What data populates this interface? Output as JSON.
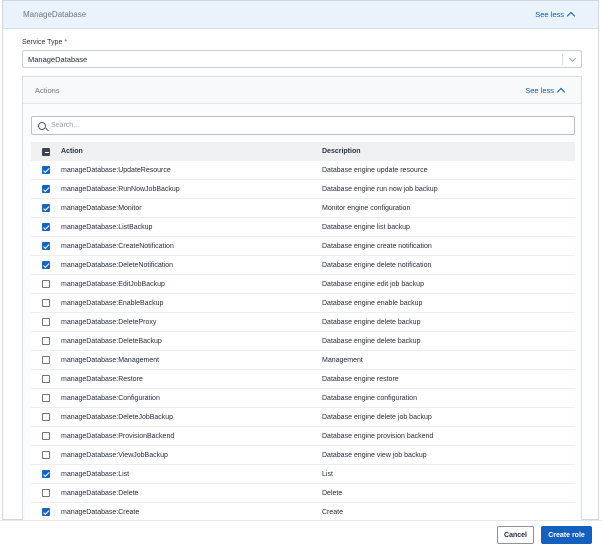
{
  "panel": {
    "title": "ManageDatabase",
    "see_less": "See less"
  },
  "service_type": {
    "label": "Service Type",
    "required_mark": "*",
    "value": "ManageDatabase"
  },
  "actions": {
    "title": "Actions",
    "see_less": "See less",
    "search_placeholder": "Search...",
    "columns": {
      "action": "Action",
      "description": "Description"
    },
    "rows": [
      {
        "action": "manageDatabase:UpdateResource",
        "description": "Database engine update resource",
        "checked": true
      },
      {
        "action": "manageDatabase:RunNowJobBackup",
        "description": "Database engine run now job backup",
        "checked": true
      },
      {
        "action": "manageDatabase:Monitor",
        "description": "Monitor engine configuration",
        "checked": true
      },
      {
        "action": "manageDatabase:ListBackup",
        "description": "Database engine list backup",
        "checked": true
      },
      {
        "action": "manageDatabase:CreateNotification",
        "description": "Database engine create notification",
        "checked": true
      },
      {
        "action": "manageDatabase:DeleteNotification",
        "description": "Database engine delete notification",
        "checked": true
      },
      {
        "action": "manageDatabase:EditJobBackup",
        "description": "Database engine edit job backup",
        "checked": false
      },
      {
        "action": "manageDatabase:EnableBackup",
        "description": "Database engine enable backup",
        "checked": false
      },
      {
        "action": "manageDatabase:DeleteProxy",
        "description": "Database engine delete backup",
        "checked": false
      },
      {
        "action": "manageDatabase:DeleteBackup",
        "description": "Database engine delete backup",
        "checked": false
      },
      {
        "action": "manageDatabase:Management",
        "description": "Management",
        "checked": false
      },
      {
        "action": "manageDatabase:Restore",
        "description": "Database engine restore",
        "checked": false
      },
      {
        "action": "manageDatabase:Configuration",
        "description": "Database engine configuration",
        "checked": false
      },
      {
        "action": "manageDatabase:DeleteJobBackup",
        "description": "Database engine delete job backup",
        "checked": false
      },
      {
        "action": "manageDatabase:ProvisionBackend",
        "description": "Database engine provision backend",
        "checked": false
      },
      {
        "action": "manageDatabase:ViewJobBackup",
        "description": "Database engine view job backup",
        "checked": false
      },
      {
        "action": "manageDatabase:List",
        "description": "List",
        "checked": true
      },
      {
        "action": "manageDatabase:Delete",
        "description": "Delete",
        "checked": false
      },
      {
        "action": "manageDatabase:Create",
        "description": "Create",
        "checked": true
      }
    ]
  },
  "footer": {
    "cancel_label": "Cancel",
    "create_label": "Create role"
  },
  "colors": {
    "accent": "#1560bd",
    "header_bg": "#eaf3fc",
    "checkbox_checked": "#1565c0"
  }
}
